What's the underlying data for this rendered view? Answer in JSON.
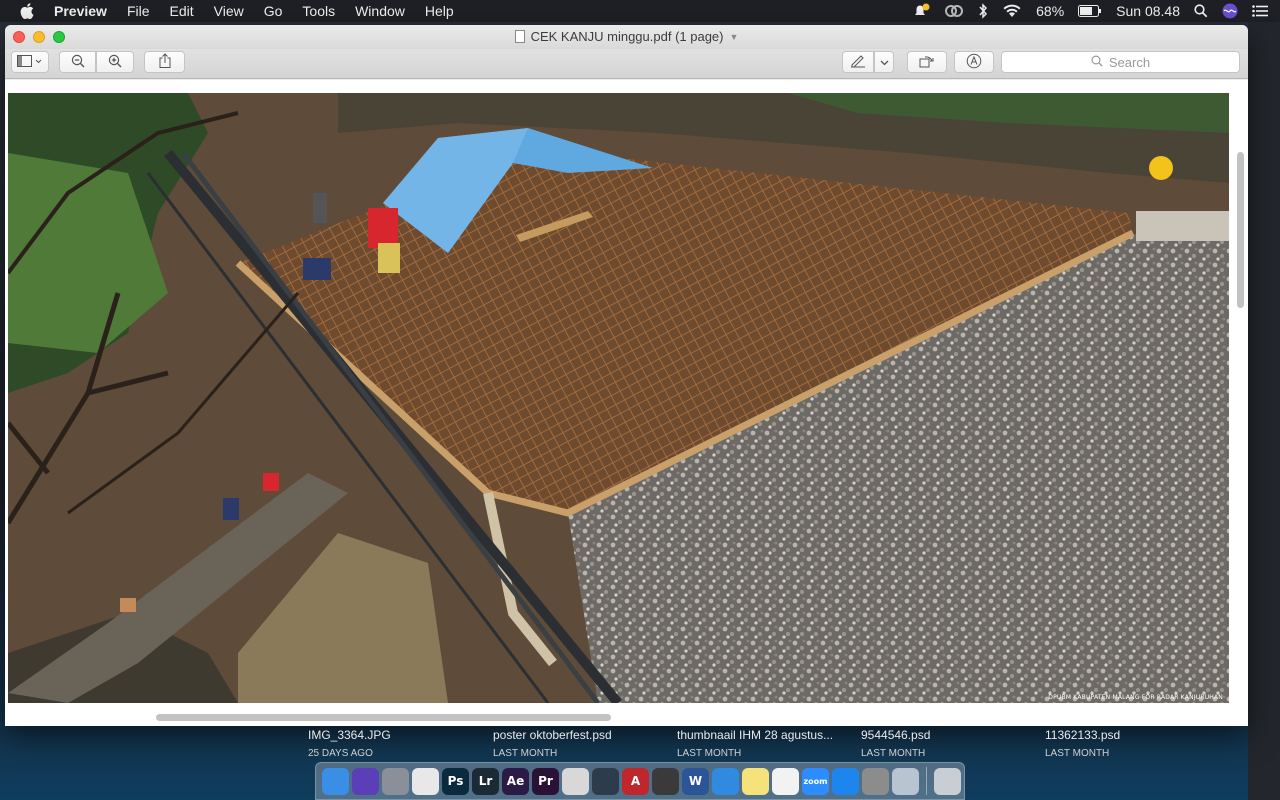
{
  "menubar": {
    "app_name": "Preview",
    "items": [
      "File",
      "Edit",
      "View",
      "Go",
      "Tools",
      "Window",
      "Help"
    ],
    "battery": "68%",
    "clock": "Sun 08.48"
  },
  "window": {
    "title": "CEK KANJU minggu.pdf (1 page)",
    "search_placeholder": "Search"
  },
  "document": {
    "image_caption": "DPUBM KABUPATEN MALANG FOR RADAR KANJURUHAN"
  },
  "desktop_files": [
    {
      "name": "IMG_3364.JPG",
      "date": "25 DAYS AGO"
    },
    {
      "name": "poster oktoberfest.psd",
      "date": "LAST MONTH"
    },
    {
      "name": "thumbnaail IHM 28 agustus...",
      "date": "LAST MONTH"
    },
    {
      "name": "9544546.psd",
      "date": "LAST MONTH"
    },
    {
      "name": "11362133.psd",
      "date": "LAST MONTH"
    }
  ],
  "dock": {
    "apps": [
      {
        "name": "finder",
        "label": "",
        "color": "#3a8ee6"
      },
      {
        "name": "siri",
        "label": "",
        "color": "#5a3fb8"
      },
      {
        "name": "launchpad",
        "label": "",
        "color": "#8a8f99"
      },
      {
        "name": "chrome",
        "label": "",
        "color": "#e8e8e8"
      },
      {
        "name": "photoshop",
        "label": "Ps",
        "color": "#0b2a3d"
      },
      {
        "name": "lightroom",
        "label": "Lr",
        "color": "#1b2a35"
      },
      {
        "name": "after-effects",
        "label": "Ae",
        "color": "#2a1a45"
      },
      {
        "name": "premiere",
        "label": "Pr",
        "color": "#2a1236"
      },
      {
        "name": "no-entry",
        "label": "",
        "color": "#d8d8d8"
      },
      {
        "name": "blender",
        "label": "",
        "color": "#2d3b4a"
      },
      {
        "name": "autocad",
        "label": "A",
        "color": "#c0272d"
      },
      {
        "name": "sublime",
        "label": "",
        "color": "#3a3a3a"
      },
      {
        "name": "word",
        "label": "W",
        "color": "#2b5597"
      },
      {
        "name": "safari",
        "label": "",
        "color": "#2f8ae0"
      },
      {
        "name": "notes",
        "label": "",
        "color": "#f5e27a"
      },
      {
        "name": "photos",
        "label": "",
        "color": "#f2f2f2"
      },
      {
        "name": "zoom",
        "label": "zoom",
        "color": "#2d8cff"
      },
      {
        "name": "app-store",
        "label": "",
        "color": "#1c86ee"
      },
      {
        "name": "system-preferences",
        "label": "",
        "color": "#8c8c8c"
      },
      {
        "name": "image-capture",
        "label": "",
        "color": "#b8c4d0"
      },
      {
        "name": "trash",
        "label": "",
        "color": "#c9ced4"
      }
    ]
  }
}
